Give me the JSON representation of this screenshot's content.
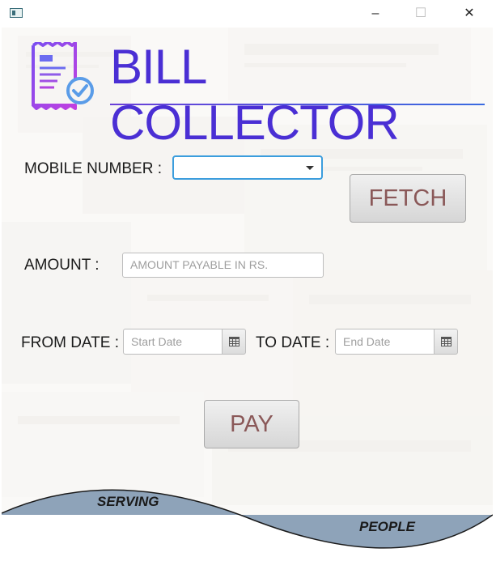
{
  "window": {
    "controls": {
      "minimize": "–",
      "maximize": "☐",
      "close": "✕"
    }
  },
  "brand": {
    "title": "BILL COLLECTOR",
    "logo_icon": "receipt-check-icon",
    "accent_color": "#4a2fd4"
  },
  "form": {
    "mobile_label": "MOBILE NUMBER :",
    "mobile_value": "",
    "amount_label": "AMOUNT :",
    "amount_placeholder": "AMOUNT PAYABLE IN RS.",
    "from_label": "FROM DATE :",
    "from_placeholder": "Start Date",
    "to_label": "TO DATE :",
    "to_placeholder": "End Date",
    "calendar_icon": "calendar-icon"
  },
  "buttons": {
    "fetch": "FETCH",
    "pay": "PAY",
    "text_color": "#8a5858"
  },
  "footer": {
    "left_text": "SERVING",
    "right_text": "PEOPLE",
    "wave_color": "#8ea3b9"
  }
}
